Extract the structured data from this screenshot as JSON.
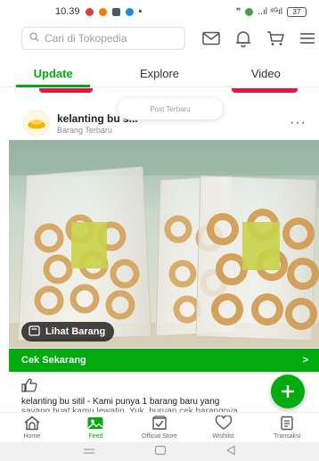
{
  "status_bar": {
    "time": "10.39",
    "network": "..ıl ⁴ᴳıl",
    "battery": "37"
  },
  "search": {
    "placeholder": "Cari di Tokopedia"
  },
  "tabs": [
    {
      "label": "Update",
      "active": true
    },
    {
      "label": "Explore",
      "active": false
    },
    {
      "label": "Video",
      "active": false
    }
  ],
  "toast": "Post Terbaru",
  "post": {
    "shop_name": "kelanting bu s...",
    "shop_subtitle": "Barang Terbaru",
    "view_button": "Lihat Barang",
    "cta_label": "Cek Sekarang",
    "caption": "kelanting bu sitil - Kami punya 1 barang baru yang",
    "caption_cut": "sayang buat kamu lewatin. Yuk, buruan cek barangnya"
  },
  "bottom_nav": [
    {
      "label": "Home",
      "icon": "home-icon",
      "active": false
    },
    {
      "label": "Feed",
      "icon": "feed-icon",
      "active": true
    },
    {
      "label": "Official Store",
      "icon": "official-store-icon",
      "active": false
    },
    {
      "label": "Wishlist",
      "icon": "heart-icon",
      "active": false
    },
    {
      "label": "Transaksi",
      "icon": "receipt-icon",
      "active": false
    }
  ],
  "colors": {
    "brand_green": "#03ac0e",
    "promo_red": "#e5173f"
  }
}
